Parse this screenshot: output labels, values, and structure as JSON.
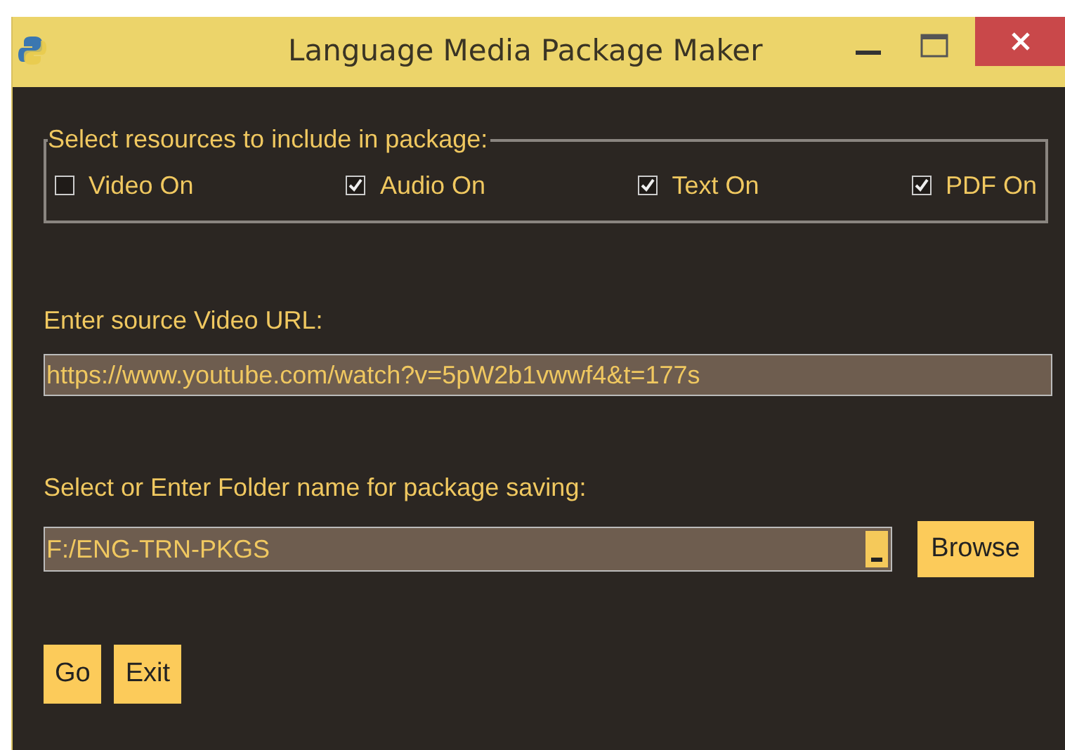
{
  "window": {
    "title": "Language Media Package Maker"
  },
  "resources": {
    "legend": "Select resources to include in package:",
    "options": [
      {
        "label": "Video On",
        "checked": false
      },
      {
        "label": "Audio On",
        "checked": true
      },
      {
        "label": "Text On",
        "checked": true
      },
      {
        "label": "PDF On",
        "checked": true
      }
    ]
  },
  "url": {
    "label": "Enter source Video URL:",
    "value": "https://www.youtube.com/watch?v=5pW2b1vwwf4&t=177s"
  },
  "folder": {
    "label": "Select or Enter Folder name for package saving:",
    "value": "F:/ENG-TRN-PKGS",
    "browse": "Browse"
  },
  "buttons": [
    "Go",
    "Exit"
  ]
}
